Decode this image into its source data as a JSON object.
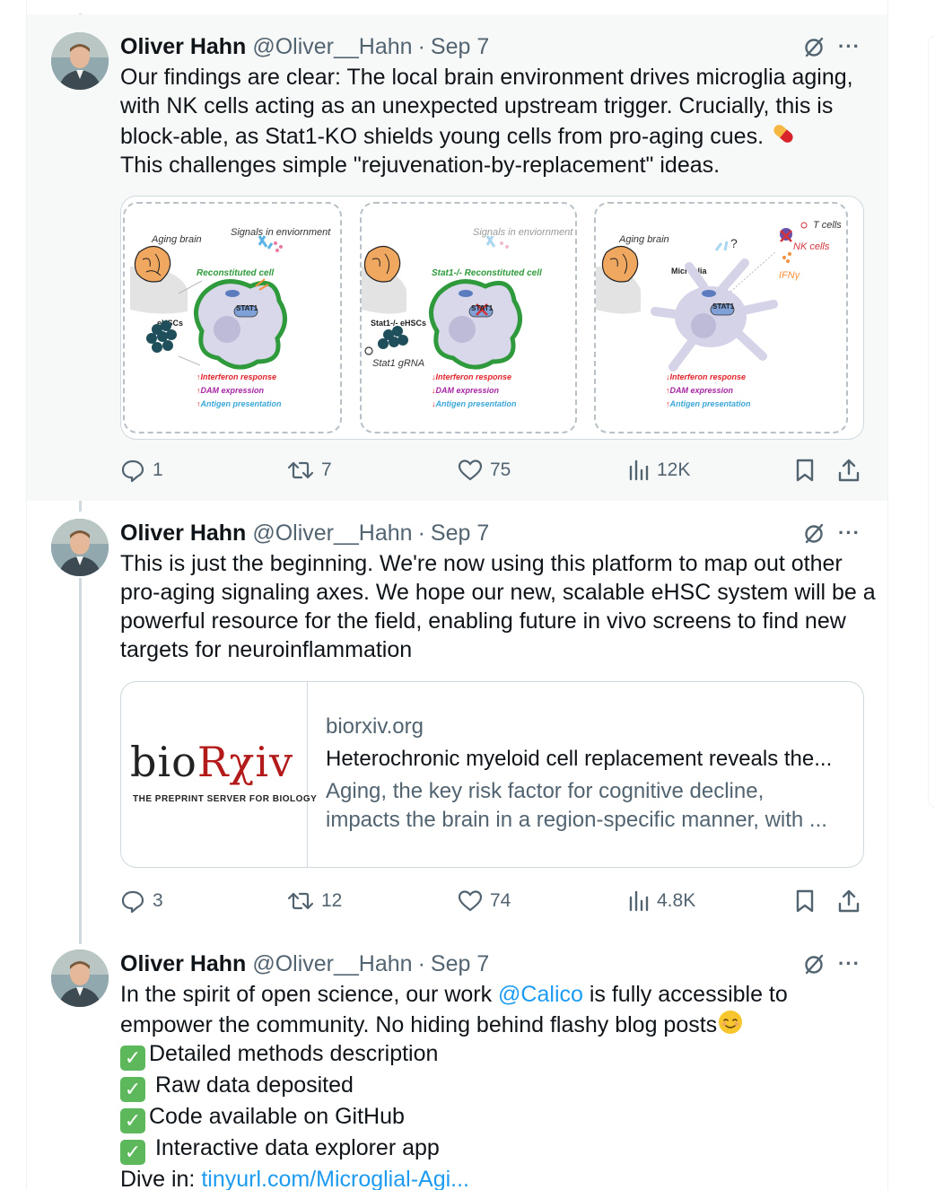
{
  "tweets": [
    {
      "author": "Oliver Hahn",
      "handle": "@Oliver__Hahn",
      "date": "Sep 7",
      "lines": [
        "Our findings are clear: The local brain environment drives microglia aging,",
        "with NK cells acting as an unexpected upstream trigger. Crucially, this is",
        "block-able, as Stat1-KO shields young cells from pro-aging cues.",
        "This challenges simple \"rejuvenation-by-replacement\" ideas."
      ],
      "media": {
        "panel1": {
          "aging_brain": "Aging brain",
          "signals": "Signals in enviornment",
          "reconstituted": "Reconstituted cell",
          "ehscs": "eHSCs",
          "stat": "STAT1",
          "out1": "Interferon response",
          "out2": "DAM expression",
          "out3": "Antigen presentation"
        },
        "panel2": {
          "signals": "Signals in enviornment",
          "reconstituted": "Stat1-/- Reconstituted cell",
          "ehscs": "Stat1-/- eHSCs",
          "grna": "Stat1 gRNA",
          "stat": "STAT1",
          "out1": "Interferon response",
          "out2": "DAM expression",
          "out3": "Antigen presentation"
        },
        "panel3": {
          "aging_brain": "Aging brain",
          "microglia": "Microglia",
          "tcells": "T cells",
          "nkcells": "NK cells",
          "ifn": "IFNγ",
          "q": "?",
          "stat": "STAT1",
          "out1": "Interferon response",
          "out2": "DAM expression",
          "out3": "Antigen presentation"
        }
      },
      "replies": "1",
      "reposts": "7",
      "likes": "75",
      "views": "12K"
    },
    {
      "author": "Oliver Hahn",
      "handle": "@Oliver__Hahn",
      "date": "Sep 7",
      "lines": [
        "This is just the beginning. We're now using this platform to map out other",
        "pro-aging signaling axes. We hope our new, scalable eHSC system will be a",
        "powerful resource for the field, enabling future in vivo screens to find new",
        "targets for neuroinflammation"
      ],
      "card": {
        "logo_text_a": "bio",
        "logo_text_b": "Rχiv",
        "logo_sub": "THE PREPRINT SERVER FOR BIOLOGY",
        "domain": "biorxiv.org",
        "title": "Heterochronic myeloid cell replacement reveals the...",
        "desc_1": "Aging, the key risk factor for cognitive decline,",
        "desc_2": "impacts the brain in a region-specific manner, with ..."
      },
      "replies": "3",
      "reposts": "12",
      "likes": "74",
      "views": "4.8K"
    },
    {
      "author": "Oliver Hahn",
      "handle": "@Oliver__Hahn",
      "date": "Sep 7",
      "line1_a": "In the spirit of open science, our work ",
      "mention": "@Calico",
      "line1_b": " is fully accessible to",
      "line2": "empower the community. No hiding behind flashy blog posts",
      "bullets": [
        "Detailed methods description",
        " Raw data deposited",
        "Code available on GitHub",
        " Interactive data explorer app"
      ],
      "dive_label": "Dive in: ",
      "dive_link": "tinyurl.com/Microglial-Agi..."
    }
  ]
}
